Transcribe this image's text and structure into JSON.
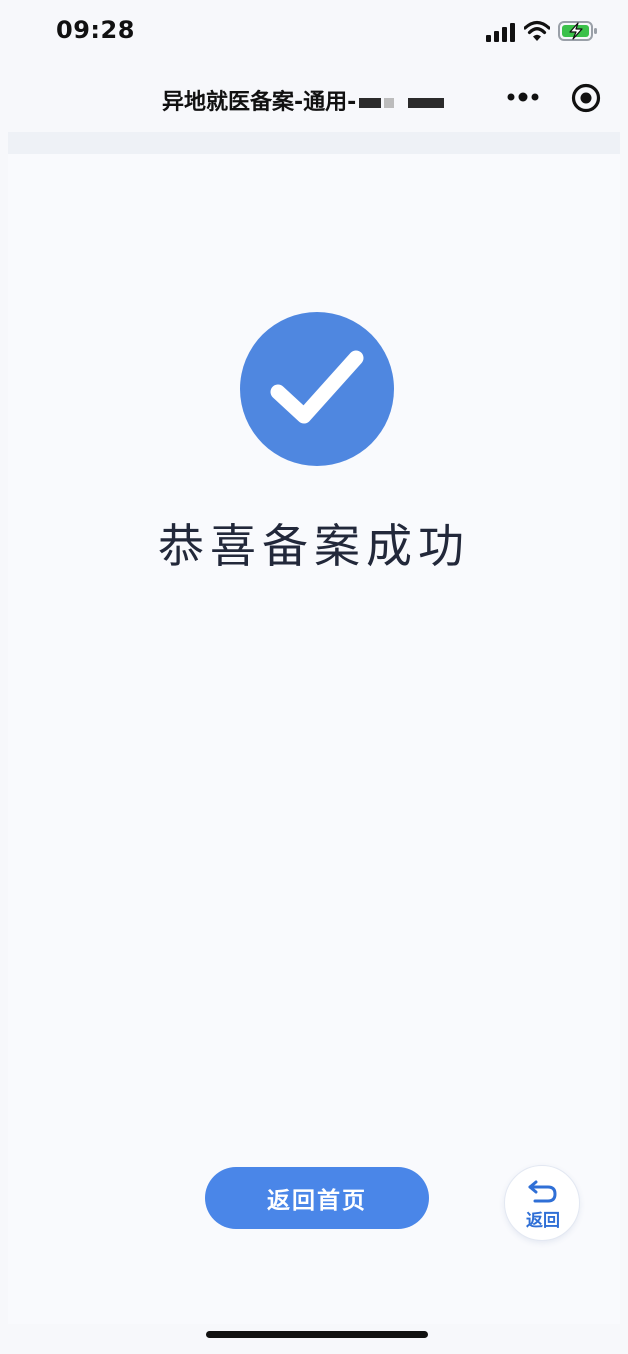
{
  "status_bar": {
    "time": "09:28",
    "icons": [
      "signal-icon",
      "wifi-icon",
      "battery-charging-icon"
    ],
    "battery_color": "#3bc14a"
  },
  "nav": {
    "title": "异地就医备案-通用-",
    "icons": [
      "more-icon",
      "capsule-target-icon"
    ]
  },
  "result": {
    "icon": "check-circle-icon",
    "icon_color": "#4f87e0",
    "message": "恭喜备案成功"
  },
  "actions": {
    "home_label": "返回首页",
    "back_label": "返回",
    "accent": "#4a86e8"
  }
}
